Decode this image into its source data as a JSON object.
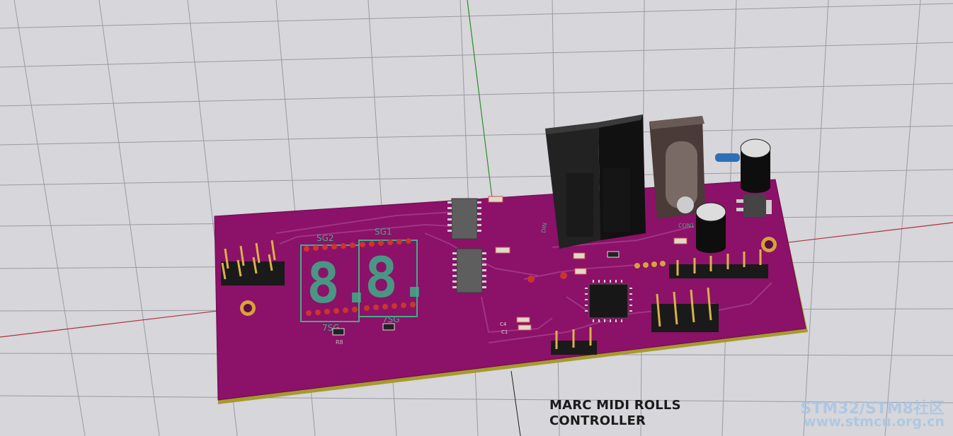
{
  "board": {
    "title_line1": "MARC MIDI ROLLS",
    "title_line2": "CONTROLLER",
    "segments": [
      {
        "ref": "SG2",
        "digits": "8.",
        "label": "7SG"
      },
      {
        "ref": "SG1",
        "digits": "8.",
        "label": "7SG"
      }
    ],
    "labels": {
      "r8": "R8",
      "con1": "CON1",
      "din": "DIN",
      "c4": "C4",
      "c1": "C1"
    }
  },
  "watermark": {
    "line1": "STM32/STM8社区",
    "line2": "www.stmcu.org.cn"
  },
  "colors": {
    "background": "#d6d6db",
    "board_pink": "#8c1168",
    "board_edge": "#a69a2e",
    "silkscreen": "#3fae8a",
    "grid": "#9a9aa2"
  },
  "icons": {
    "mcu": "ic-chip-icon",
    "midi": "din-connector-icon",
    "power": "barrel-jack-icon"
  }
}
